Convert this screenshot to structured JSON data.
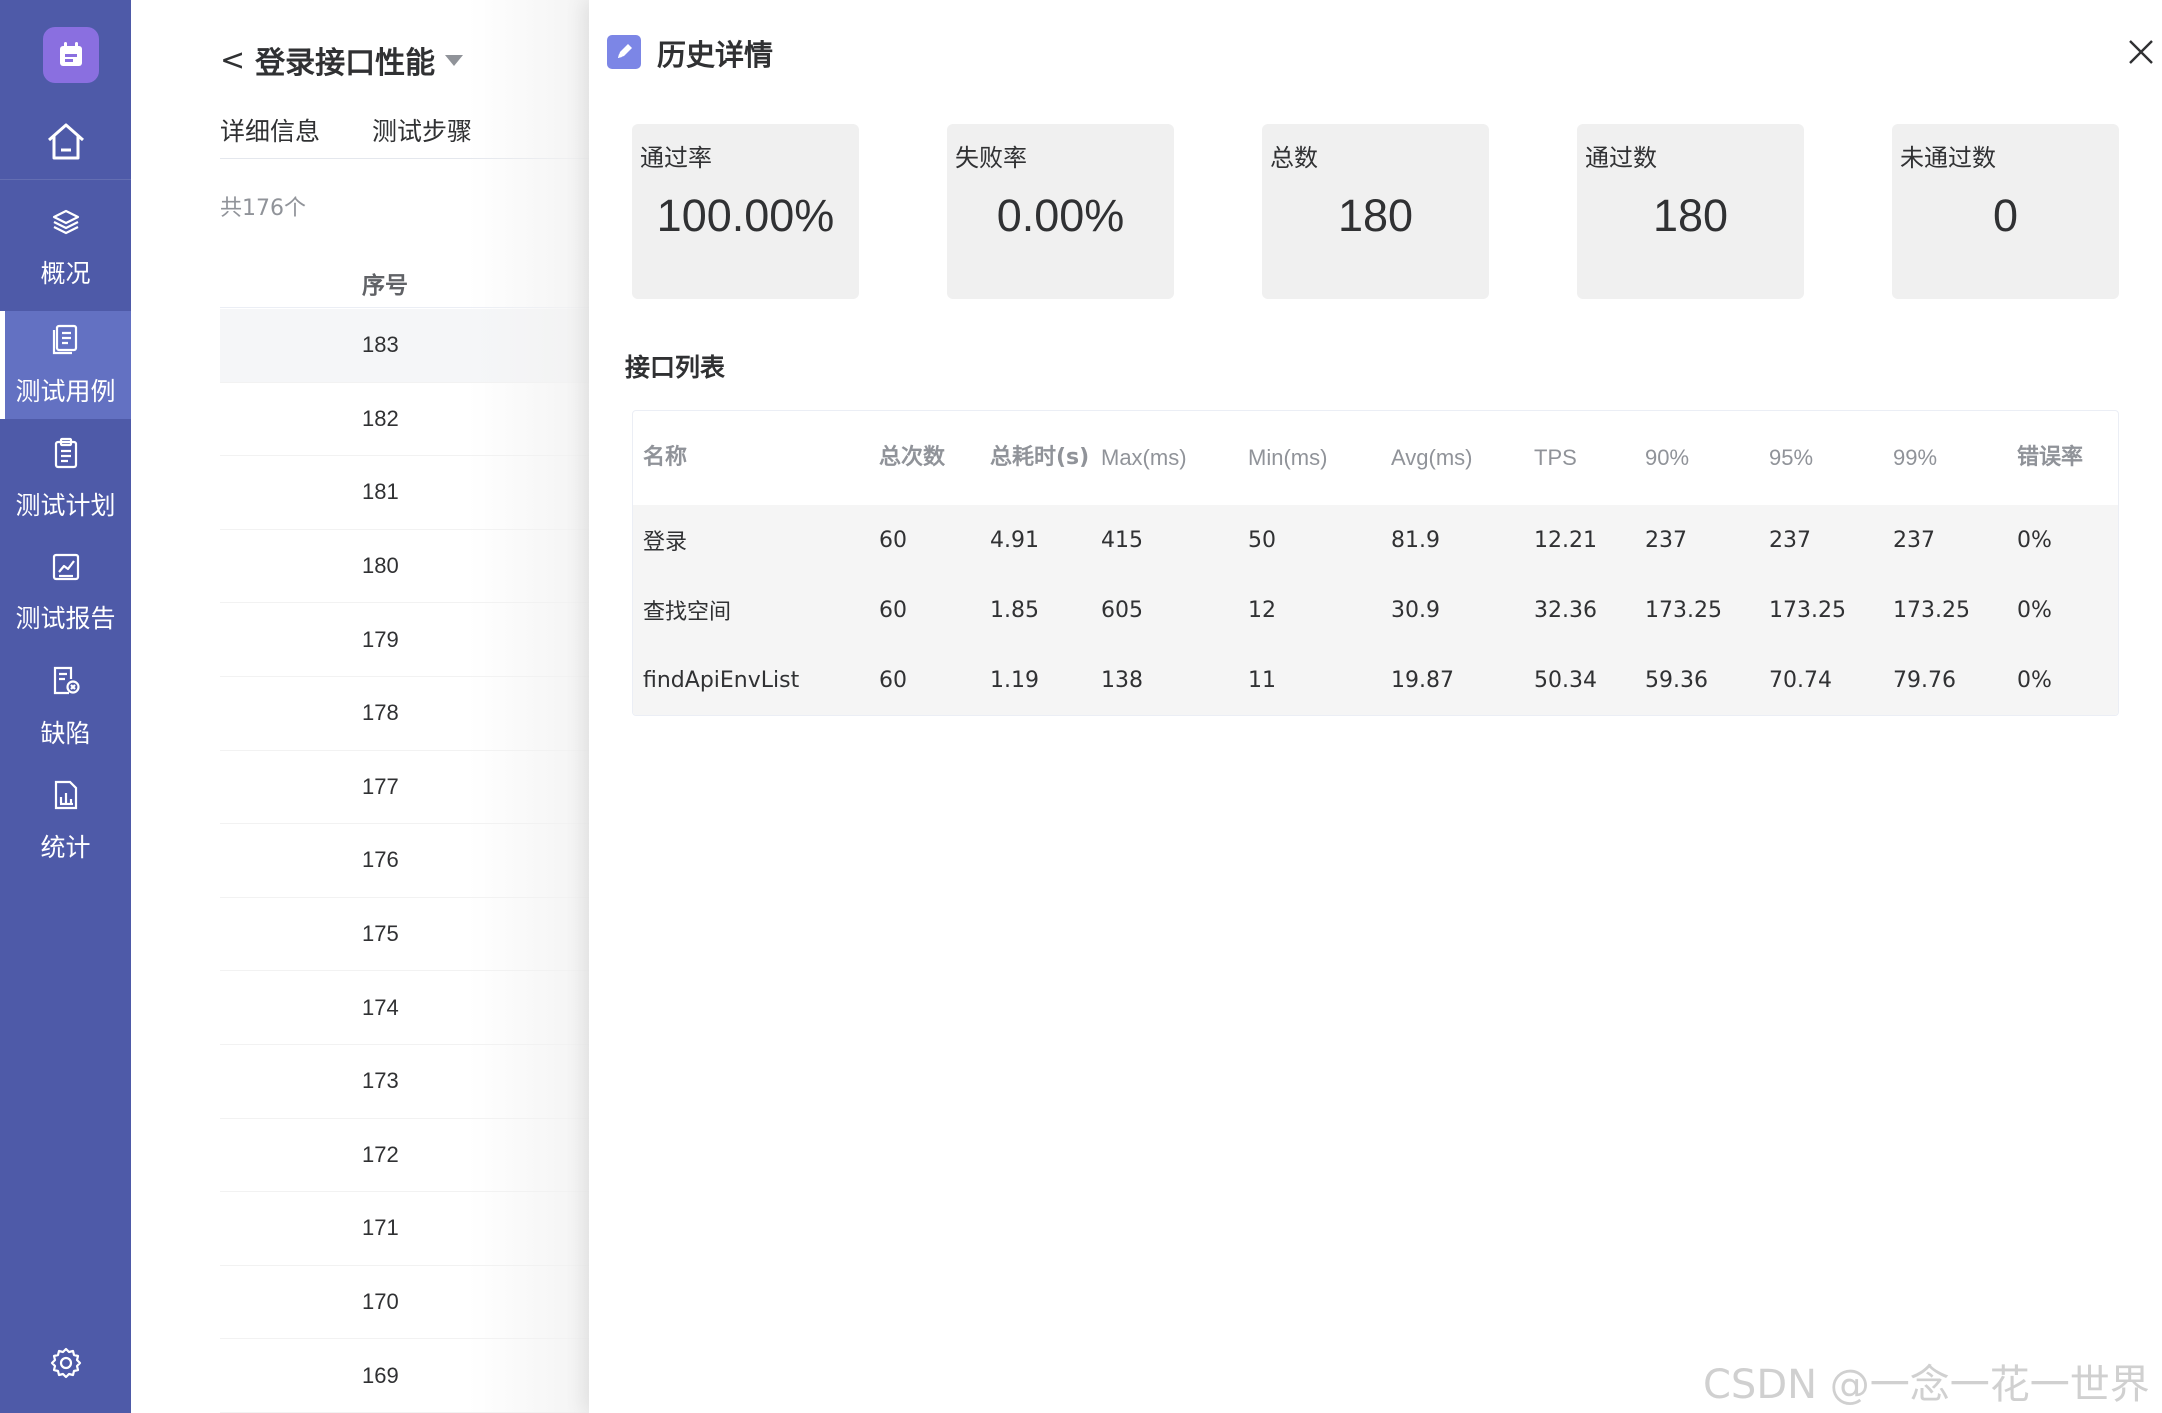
{
  "sidebar": {
    "logo_icon": "calendar-icon",
    "home_icon": "home-icon",
    "items": [
      {
        "label": "概况",
        "icon": "layers-icon"
      },
      {
        "label": "测试用例",
        "icon": "document-icon"
      },
      {
        "label": "测试计划",
        "icon": "clipboard-icon"
      },
      {
        "label": "测试报告",
        "icon": "chart-report-icon"
      },
      {
        "label": "缺陷",
        "icon": "bug-report-icon"
      },
      {
        "label": "统计",
        "icon": "statistics-icon"
      }
    ],
    "active_index": 1,
    "settings_icon": "gear-icon",
    "accent_color": "#4e5aa8"
  },
  "background_page": {
    "title": "登录接口性能",
    "tabs": [
      "详细信息",
      "测试步骤"
    ],
    "total_text": "共176个",
    "column_header": "序号",
    "rows": [
      "183",
      "182",
      "181",
      "180",
      "179",
      "178",
      "177",
      "176",
      "175",
      "174",
      "173",
      "172",
      "171",
      "170",
      "169"
    ]
  },
  "drawer": {
    "title": "历史详情",
    "stats": [
      {
        "label": "通过率",
        "value": "100.00%"
      },
      {
        "label": "失败率",
        "value": "0.00%"
      },
      {
        "label": "总数",
        "value": "180"
      },
      {
        "label": "通过数",
        "value": "180"
      },
      {
        "label": "未通过数",
        "value": "0"
      }
    ],
    "section_title": "接口列表",
    "table": {
      "headers": [
        "名称",
        "总次数",
        "总耗时(s)",
        "Max(ms)",
        "Min(ms)",
        "Avg(ms)",
        "TPS",
        "90%",
        "95%",
        "99%",
        "错误率"
      ],
      "rows": [
        [
          "登录",
          "60",
          "4.91",
          "415",
          "50",
          "81.9",
          "12.21",
          "237",
          "237",
          "237",
          "0%"
        ],
        [
          "查找空间",
          "60",
          "1.85",
          "605",
          "12",
          "30.9",
          "32.36",
          "173.25",
          "173.25",
          "173.25",
          "0%"
        ],
        [
          "findApiEnvList",
          "60",
          "1.19",
          "138",
          "11",
          "19.87",
          "50.34",
          "59.36",
          "70.74",
          "79.76",
          "0%"
        ]
      ]
    }
  },
  "watermark": "CSDN @一念一花一世界"
}
